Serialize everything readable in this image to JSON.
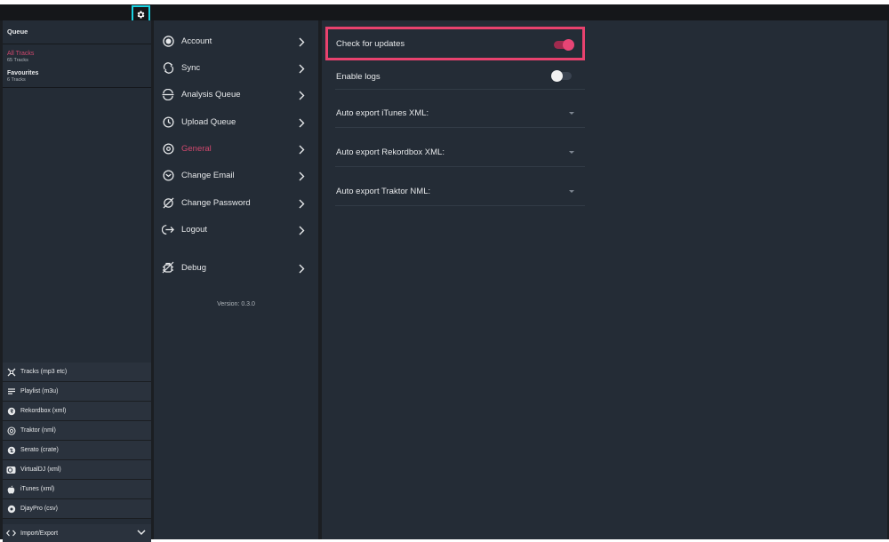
{
  "sidebar": {
    "queue_label": "Queue",
    "libraries": [
      {
        "title": "All Tracks",
        "count": "65 Tracks"
      },
      {
        "title": "Favourites",
        "count": "6 Tracks"
      }
    ],
    "formats": [
      {
        "label": "Tracks (mp3 etc)",
        "icon": "tracks-icon"
      },
      {
        "label": "Playlist (m3u)",
        "icon": "playlist-icon"
      },
      {
        "label": "Rekordbox (xml)",
        "icon": "rekordbox-icon"
      },
      {
        "label": "Traktor (nml)",
        "icon": "traktor-icon"
      },
      {
        "label": "Serato (crate)",
        "icon": "serato-icon"
      },
      {
        "label": "VirtualDJ (xml)",
        "icon": "virtualdj-icon"
      },
      {
        "label": "iTunes (xml)",
        "icon": "apple-icon"
      },
      {
        "label": "DjayPro (csv)",
        "icon": "djaypro-icon"
      }
    ],
    "import_export_label": "Import/Export"
  },
  "menu": {
    "items": [
      {
        "label": "Account",
        "icon": "account-icon"
      },
      {
        "label": "Sync",
        "icon": "sync-icon"
      },
      {
        "label": "Analysis Queue",
        "icon": "analysis-queue-icon"
      },
      {
        "label": "Upload Queue",
        "icon": "upload-queue-icon"
      },
      {
        "label": "General",
        "icon": "general-icon",
        "active": true
      },
      {
        "label": "Change Email",
        "icon": "change-email-icon"
      },
      {
        "label": "Change Password",
        "icon": "change-password-icon"
      },
      {
        "label": "Logout",
        "icon": "logout-icon"
      },
      {
        "label": "Debug",
        "icon": "debug-icon"
      }
    ],
    "version": "Version: 0.3.0"
  },
  "general": {
    "check_updates": {
      "label": "Check for updates",
      "enabled": true
    },
    "enable_logs": {
      "label": "Enable logs",
      "enabled": false
    },
    "auto_export_itunes": {
      "label": "Auto export iTunes XML:",
      "value": ""
    },
    "auto_export_rekordbox": {
      "label": "Auto export Rekordbox XML:",
      "value": ""
    },
    "auto_export_traktor": {
      "label": "Auto export Traktor NML:",
      "value": ""
    }
  },
  "colors": {
    "accent": "#e64575",
    "highlight_border": "#e8426e",
    "focus_outline": "#19d3e3",
    "panel_bg": "#242c36"
  }
}
